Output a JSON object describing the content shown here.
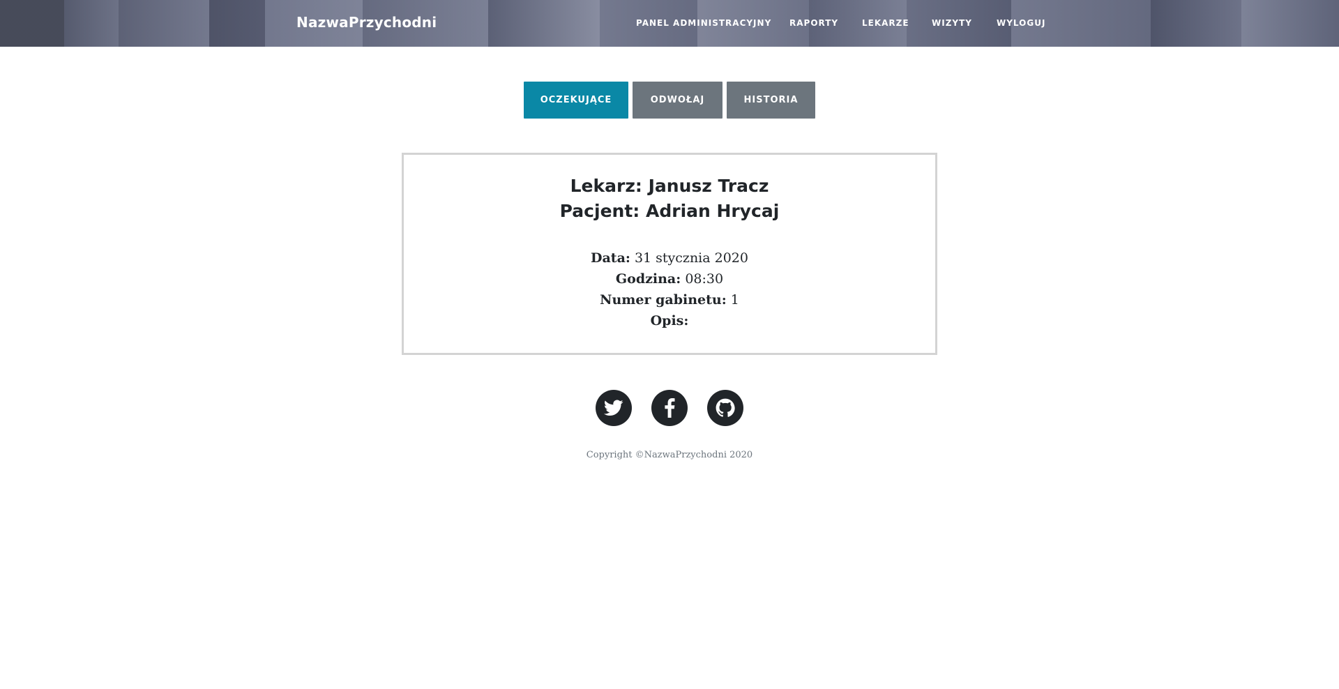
{
  "navbar": {
    "brand": "NazwaPrzychodni",
    "links": [
      "Panel Administracyjny",
      "Raporty",
      "Lekarze",
      "Wizyty",
      "Wyloguj"
    ]
  },
  "tabs": [
    {
      "label": "Oczekujące",
      "active": true
    },
    {
      "label": "Odwołaj",
      "active": false
    },
    {
      "label": "Historia",
      "active": false
    }
  ],
  "visit": {
    "doctor_label": "Lekarz:",
    "doctor": "Janusz Tracz",
    "patient_label": "Pacjent:",
    "patient": "Adrian Hrycaj",
    "date_label": "Data:",
    "date": "31 stycznia 2020",
    "time_label": "Godzina:",
    "time": "08:30",
    "room_label": "Numer gabinetu:",
    "room": "1",
    "description_label": "Opis:",
    "description": ""
  },
  "social": [
    "twitter-icon",
    "facebook-icon",
    "github-icon"
  ],
  "footer": {
    "copyright": "Copyright ©NazwaPrzychodni 2020"
  },
  "colors": {
    "accent": "#0a88a6",
    "secondary": "#6c757d",
    "dark": "#212529",
    "card_border": "#d3d3d3"
  }
}
